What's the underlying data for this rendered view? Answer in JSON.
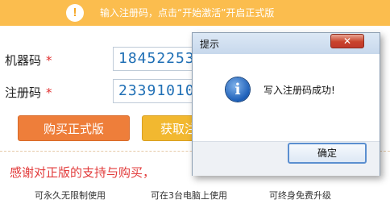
{
  "banner": {
    "icon": "exclamation-icon",
    "text": "输入注册码，点击“开始激活”开启正式版",
    "color": "#fbbd4e"
  },
  "form": {
    "machine_code_label": "机器码",
    "machine_code_value": "18452253",
    "register_code_label": "注册码",
    "register_code_value": "23391010",
    "required_mark": "*"
  },
  "buttons": {
    "buy_label": "购买正式版",
    "get_label": "获取注册码",
    "buy_color": "#ee7e3a",
    "get_color": "#f2b830"
  },
  "promo": {
    "thanks": "感谢对正版的支持与购买，",
    "features": [
      "可永久无限制使用",
      "可在3台电脑上使用",
      "可终身免费升级"
    ]
  },
  "dialog": {
    "title": "提示",
    "close_label": "✕",
    "icon": "info-icon",
    "icon_glyph": "i",
    "message": "写入注册码成功!",
    "ok_label": "确定"
  }
}
